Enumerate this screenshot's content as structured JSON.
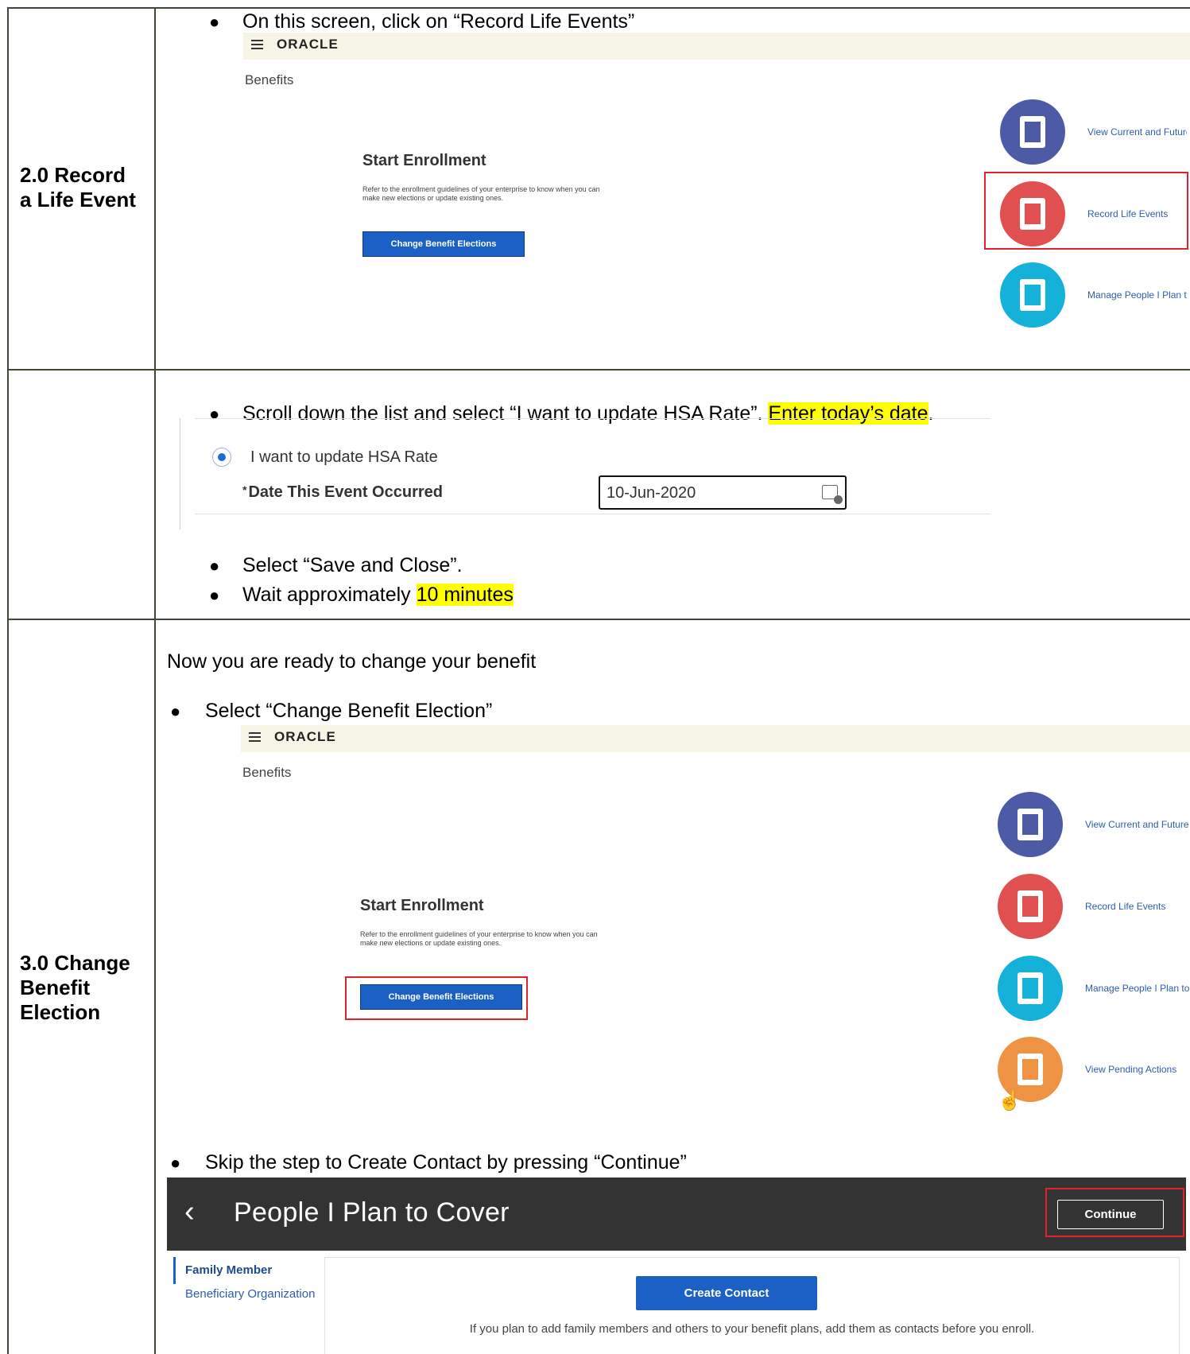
{
  "row1": {
    "title_line1": "2.0 Record",
    "title_line2": "a Life Event",
    "instruction": "On this screen, click on “Record Life Events”",
    "bullet": "●"
  },
  "oracle_screen": {
    "logo": "ORACLE",
    "section_label": "Benefits",
    "start_title": "Start Enrollment",
    "start_desc": "Refer to the enrollment guidelines of your enterprise to know when you can make new elections or update existing ones.",
    "change_button": "Change Benefit Elections",
    "links": {
      "view_current": "View Current and Future",
      "record_life": "Record Life Events",
      "manage_people": "Manage People I Plan to Cover",
      "view_pending": "View Pending Actions"
    },
    "colors": {
      "blue": "#4d5aa6",
      "red": "#e05050",
      "cyan": "#14b1d9",
      "orange": "#ee9343",
      "highlight_box": "#e0232b"
    }
  },
  "row2": {
    "instruction_pre": "Scroll down the list and select “I want to update HSA Rate”.  ",
    "instruction_hl": "Enter today’s date",
    "instruction_post": ".",
    "radio_label": "I want to update HSA Rate",
    "date_label": "Date This Event Occurred",
    "required_mark": "*",
    "date_value": "10-Jun-2020",
    "bullet2": "Select “Save and Close”.",
    "bullet3_pre": "Wait approximately ",
    "bullet3_hl": "10 minutes",
    "bullet": "●",
    "highlight_color": "#ffff00"
  },
  "row3": {
    "title_line1": "3.0 Change",
    "title_line2": "Benefit",
    "title_line3": "Election",
    "intro": "Now you are ready to change your benefit",
    "bullet1": "Select “Change Benefit Election”",
    "bullet2": "Skip the step to Create Contact by pressing “Continue”",
    "bullet": "●"
  },
  "pipc_screen": {
    "back_icon": "‹",
    "title": "People I Plan to Cover",
    "continue_button": "Continue",
    "nav_active": "Family Member",
    "nav_item": "Beneficiary Organization",
    "create_button": "Create Contact",
    "help_text": "If you plan to add family members and others to your benefit plans, add them as contacts before you enroll."
  }
}
